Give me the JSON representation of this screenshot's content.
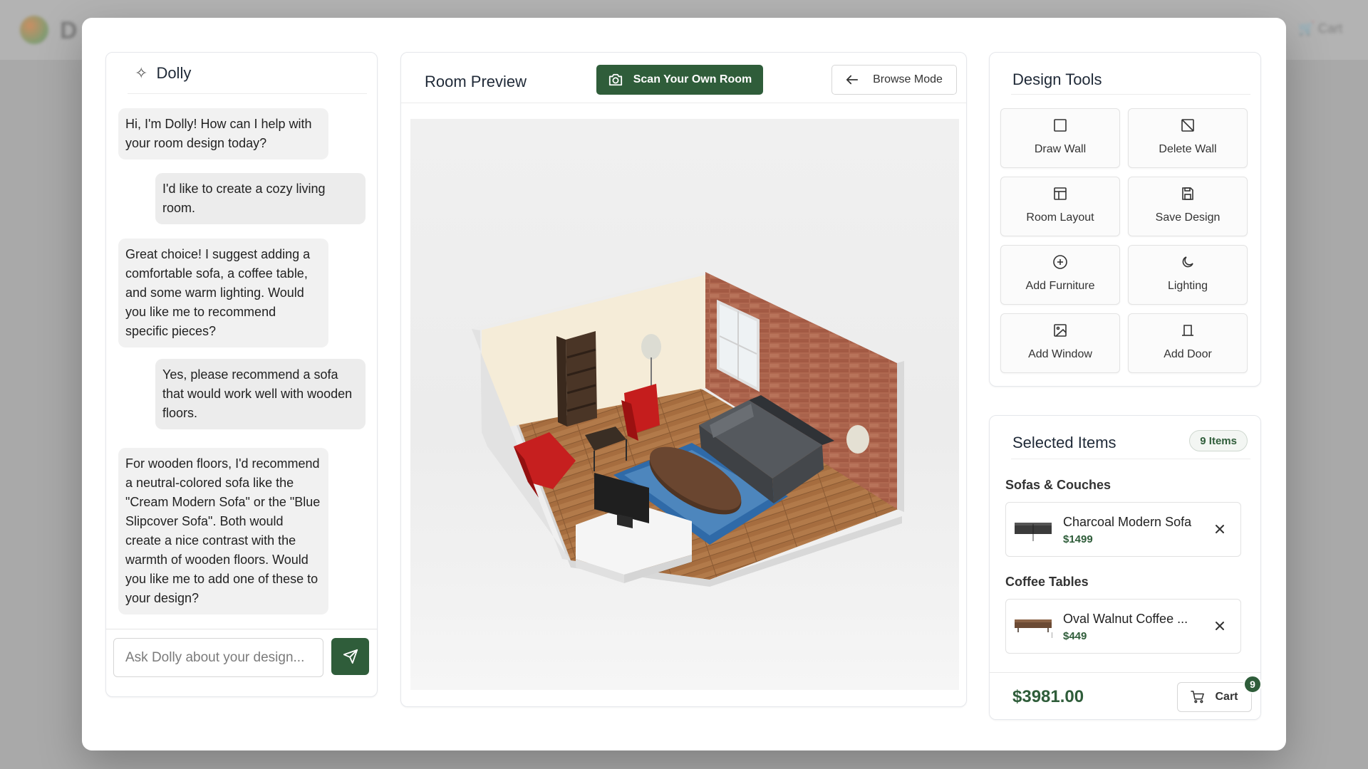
{
  "background": {
    "brand": "D",
    "cart_label": "Cart"
  },
  "chat": {
    "title": "Dolly",
    "messages": [
      {
        "role": "bot",
        "text": "Hi, I'm Dolly! How can I help with your room design today?"
      },
      {
        "role": "user",
        "text": "I'd like to create a cozy living room."
      },
      {
        "role": "bot",
        "text": "Great choice! I suggest adding a comfortable sofa, a coffee table, and some warm lighting. Would you like me to recommend specific pieces?"
      },
      {
        "role": "user",
        "text": "Yes, please recommend a sofa that would work well with wooden floors."
      },
      {
        "role": "bot",
        "text": "For wooden floors, I'd recommend a neutral-colored sofa like the \"Cream Modern Sofa\" or the \"Blue Slipcover Sofa\". Both would create a nice contrast with the warmth of wooden floors. Would you like me to add one of these to your design?"
      }
    ],
    "input_placeholder": "Ask Dolly about your design...",
    "input_value": ""
  },
  "preview": {
    "title": "Room Preview",
    "scan_label": "Scan Your Own Room",
    "browse_label": "Browse Mode"
  },
  "tools": {
    "title": "Design Tools",
    "items": [
      {
        "label": "Draw Wall",
        "icon": "square-icon"
      },
      {
        "label": "Delete Wall",
        "icon": "square-slash-icon"
      },
      {
        "label": "Room Layout",
        "icon": "layout-icon"
      },
      {
        "label": "Save Design",
        "icon": "save-icon"
      },
      {
        "label": "Add Furniture",
        "icon": "plus-circle-icon"
      },
      {
        "label": "Lighting",
        "icon": "moon-icon"
      },
      {
        "label": "Add Window",
        "icon": "image-icon"
      },
      {
        "label": "Add Door",
        "icon": "door-icon"
      }
    ]
  },
  "selected": {
    "title": "Selected Items",
    "badge": "9 Items",
    "categories": [
      {
        "name": "Sofas & Couches",
        "items": [
          {
            "name": "Charcoal Modern Sofa",
            "price": "$1499"
          }
        ]
      },
      {
        "name": "Coffee Tables",
        "items": [
          {
            "name": "Oval Walnut Coffee ...",
            "price": "$449"
          }
        ]
      }
    ],
    "total": "$3981.00",
    "cart_label": "Cart",
    "cart_count": "9"
  },
  "colors": {
    "accent": "#2f5d3a",
    "accent_light": "#f3f6f3"
  }
}
